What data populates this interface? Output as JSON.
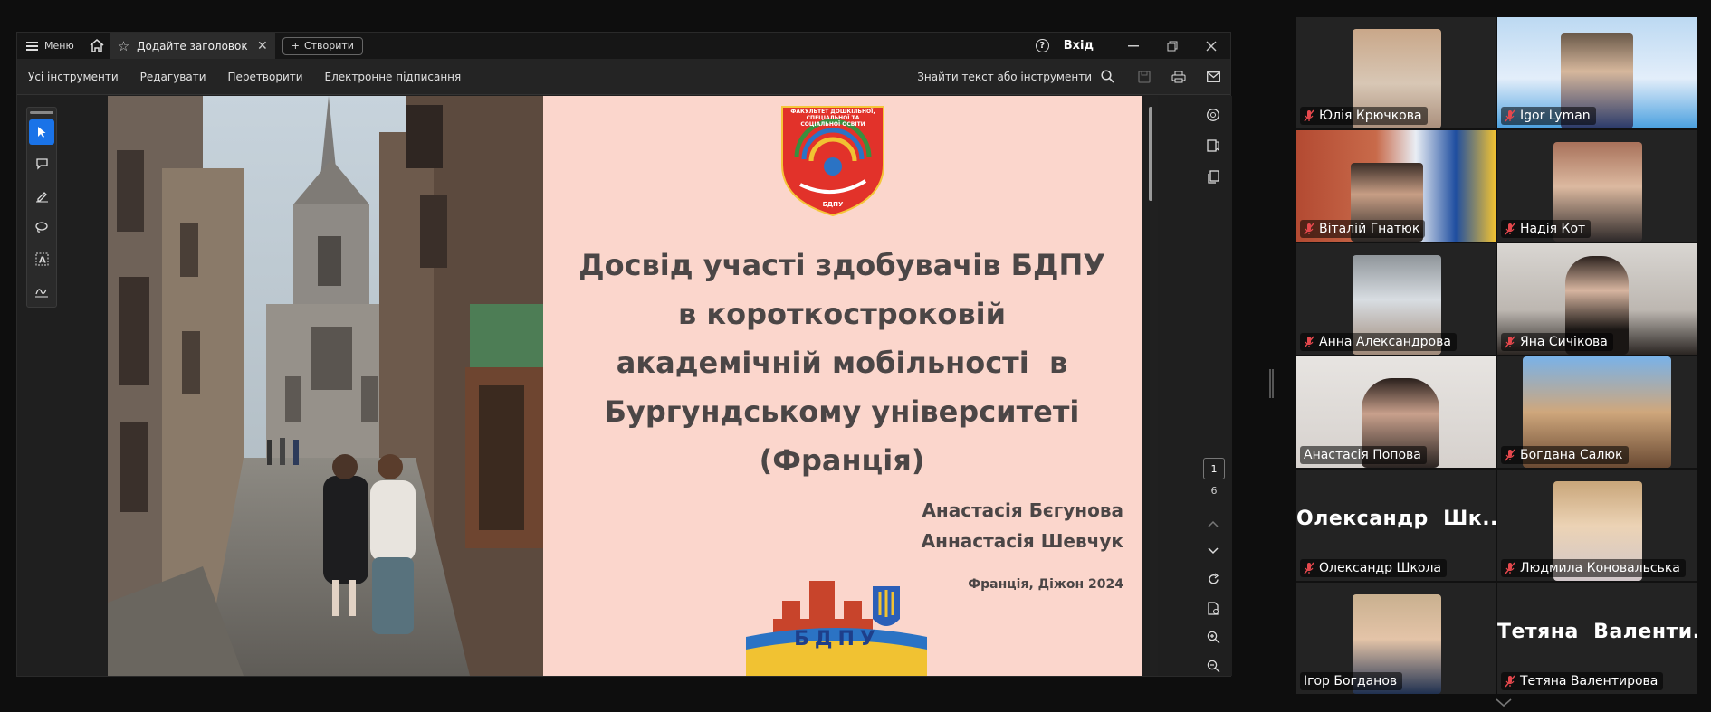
{
  "viewer": {
    "menu_label": "Меню",
    "tab_title": "Додайте заголовок",
    "create_label": "Створити",
    "help_glyph": "?",
    "signin_label": "Вхід",
    "toolbar": [
      "Усі інструменти",
      "Редагувати",
      "Перетворити",
      "Електронне підписання"
    ],
    "find_placeholder": "Знайти текст або інструменти",
    "page_current": "1",
    "page_total": "6"
  },
  "slide": {
    "logo_top_text": "ФАКУЛЬТЕТ ДОШКІЛЬНОЇ, СПЕЦІАЛЬНОЇ ТА СОЦІАЛЬНОЇ ОСВІТИ",
    "logo_bottom_text": "БДПУ",
    "title_lines": [
      "Досвід участі здобувачів БДПУ",
      "в короткостроковій",
      "академічній мобільності  в",
      "Бургундському університеті",
      "(Франція)"
    ],
    "author1": "Анастасія Бєгунова",
    "author2": "Аннастасія Шевчук",
    "place": "Франція, Діжон 2024",
    "footer_logo_text": "БДПУ"
  },
  "participants": [
    {
      "name": "Юлія Крючкова",
      "muted": true,
      "video": true
    },
    {
      "name": "Igor Lyman",
      "muted": true,
      "video": true
    },
    {
      "name": "Віталій Гнатюк",
      "muted": true,
      "video": true
    },
    {
      "name": "Надія Кот",
      "muted": true,
      "video": true
    },
    {
      "name": "Анна Александрова",
      "muted": true,
      "video": true
    },
    {
      "name": "Яна Сичікова",
      "muted": true,
      "video": true
    },
    {
      "name": "Анастасія Попова",
      "muted": false,
      "video": true,
      "speaking": true
    },
    {
      "name": "Богдана Салюк",
      "muted": true,
      "video": true
    },
    {
      "name": "Олександр Школа",
      "big_name": "Олександр  Шк...",
      "muted": true,
      "video": false
    },
    {
      "name": "Людмила Коновальська",
      "muted": true,
      "video": true
    },
    {
      "name": "Ігор Богданов",
      "muted": false,
      "video": true
    },
    {
      "name": "Тетяна Валентирова",
      "big_name": "Тетяна  Валенти...",
      "muted": true,
      "video": false
    }
  ],
  "more_label": "···",
  "colors": {
    "accent": "#1a73e8",
    "speaking": "#2bd67b",
    "muted_mic": "#e5484d",
    "slide_bg": "#fbd6cc"
  }
}
